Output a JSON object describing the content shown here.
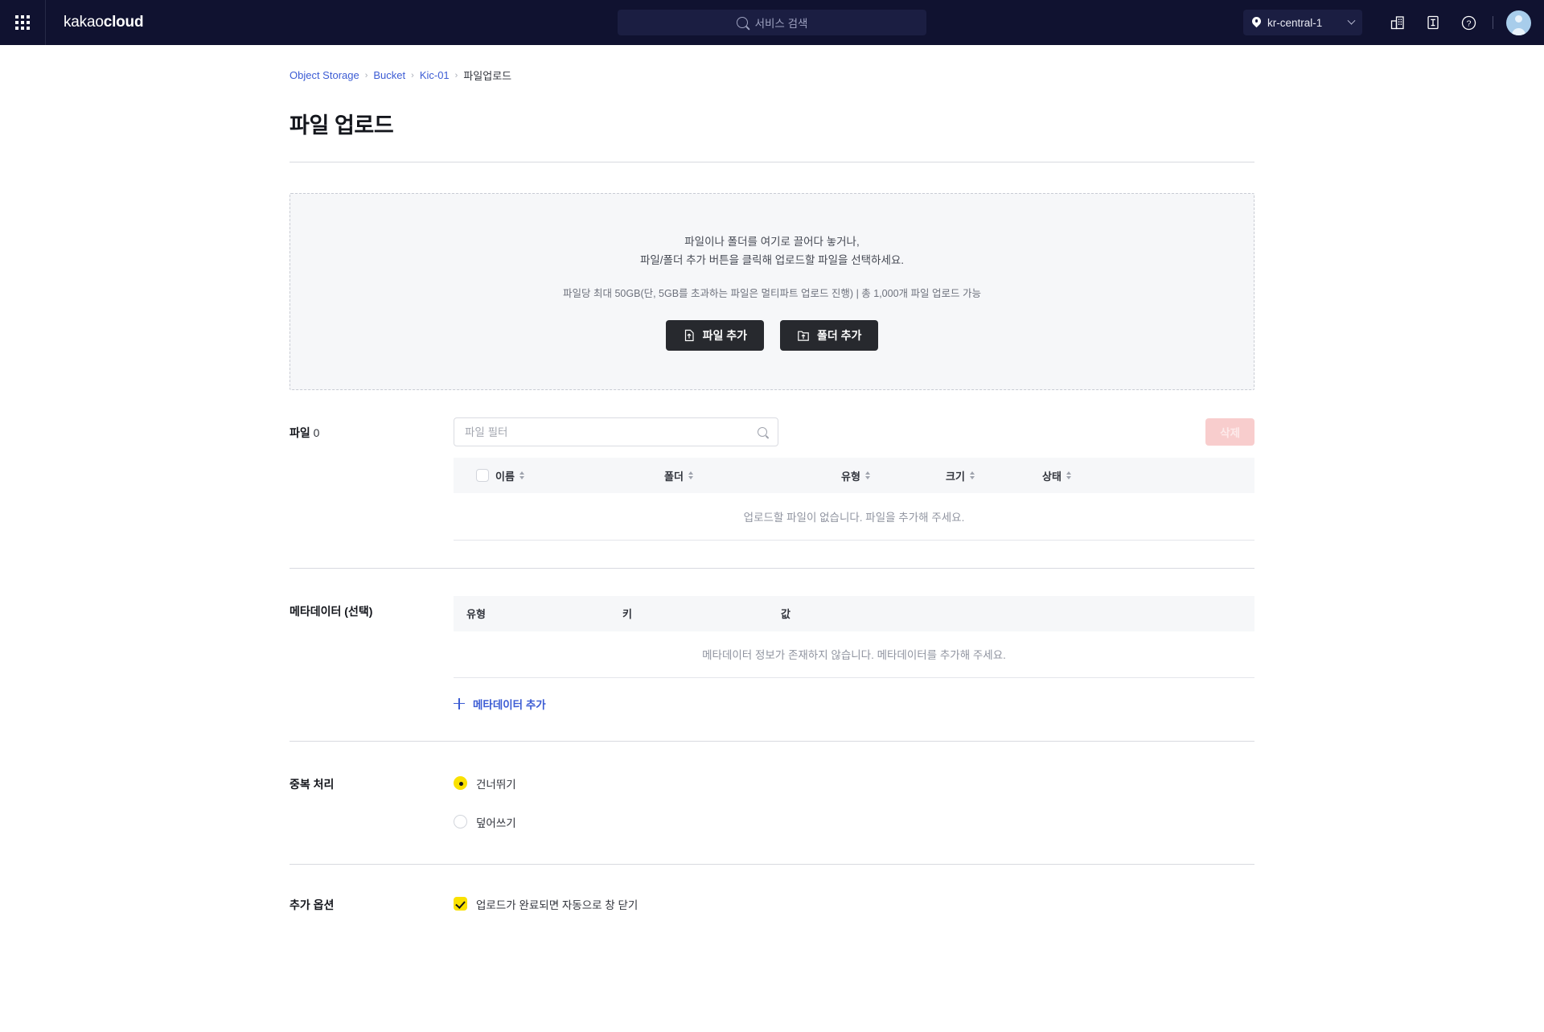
{
  "topbar": {
    "apps_icon": "apps-grid-icon",
    "brand_light": "kakao",
    "brand_bold": "cloud",
    "search": {
      "icon": "search-icon",
      "placeholder": "서비스 검색"
    },
    "region": {
      "icon": "location-pin-icon",
      "value": "kr-central-1",
      "chevron": "chevron-down-icon"
    },
    "icons": [
      {
        "name": "organization-icon"
      },
      {
        "name": "docs-icon"
      },
      {
        "name": "help-icon"
      }
    ],
    "avatar": "user-avatar"
  },
  "breadcrumb": {
    "items": [
      {
        "label": "Object Storage",
        "link": true
      },
      {
        "label": "Bucket",
        "link": true
      },
      {
        "label": "Kic-01",
        "link": true
      },
      {
        "label": "파일업로드",
        "link": false
      }
    ],
    "separator": "›"
  },
  "page": {
    "title": "파일 업로드"
  },
  "dropzone": {
    "line1": "파일이나 폴더를 여기로 끌어다 놓거나,",
    "line2": "파일/폴더 추가 버튼을 클릭해 업로드할 파일을 선택하세요.",
    "note": "파일당 최대 50GB(단, 5GB를 초과하는 파일은 멀티파트 업로드 진행) | 총 1,000개 파일 업로드 가능",
    "add_file_button": "파일 추가",
    "add_folder_button": "폴더 추가"
  },
  "files": {
    "label": "파일",
    "count": "0",
    "filter_placeholder": "파일 필터",
    "filter_value": "",
    "delete_button": "삭제",
    "columns": [
      "이름",
      "폴더",
      "유형",
      "크기",
      "상태"
    ],
    "empty_text": "업로드할 파일이 없습니다. 파일을 추가해 주세요.",
    "rows": []
  },
  "metadata": {
    "label": "메타데이터 (선택)",
    "columns": [
      "유형",
      "키",
      "값"
    ],
    "empty_text": "메타데이터 정보가 존재하지 않습니다. 메타데이터를 추가해 주세요.",
    "add_link": "메타데이터 추가",
    "rows": []
  },
  "duplicate": {
    "label": "중복 처리",
    "options": [
      {
        "label": "건너뛰기",
        "selected": true
      },
      {
        "label": "덮어쓰기",
        "selected": false
      }
    ]
  },
  "extra_options": {
    "label": "추가 옵션",
    "checkbox_label": "업로드가 완료되면 자동으로 창 닫기",
    "checked": true
  },
  "colors": {
    "header_bg": "#101230",
    "accent_yellow": "#FAE100",
    "link_blue": "#3C5CD4",
    "danger_disabled": "#F8CDCD",
    "button_dark": "#27292E"
  }
}
